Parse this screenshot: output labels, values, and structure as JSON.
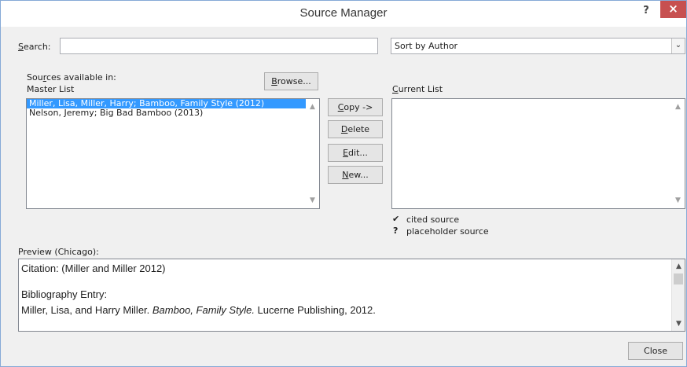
{
  "title": "Source Manager",
  "title_buttons": {
    "help": "?",
    "close": "×"
  },
  "search": {
    "label_key": "S",
    "label_rest": "earch:",
    "value": ""
  },
  "sort": {
    "selected": "Sort by Author",
    "arrow": "⌄"
  },
  "sources_available": {
    "prefix": "Sou",
    "key": "r",
    "suffix": "ces available in:",
    "list_name": "Master List"
  },
  "browse": {
    "key": "B",
    "rest": "rowse..."
  },
  "master_list": {
    "items": [
      "Miller, Lisa, Miller, Harry; Bamboo, Family Style (2012)",
      "Nelson, Jeremy; Big Bad Bamboo (2013)"
    ],
    "selected_index": 0
  },
  "actions": {
    "copy": {
      "key": "C",
      "rest": "opy ->"
    },
    "delete": {
      "key": "D",
      "rest": "elete"
    },
    "edit": {
      "key": "E",
      "rest": "dit..."
    },
    "new": {
      "key": "N",
      "rest": "ew..."
    }
  },
  "current_list": {
    "key": "C",
    "rest": "urrent List",
    "items": []
  },
  "legend": [
    {
      "symbol": "✔",
      "text": "cited source"
    },
    {
      "symbol": "?",
      "text": "placeholder source"
    }
  ],
  "preview": {
    "label": "Preview (Chicago):",
    "citation": "Citation:  (Miller and Miller 2012)",
    "bibliography_heading": "Bibliography Entry:",
    "bib_before": "Miller, Lisa, and Harry Miller. ",
    "bib_title": "Bamboo, Family Style.",
    "bib_after": " Lucerne Publishing, 2012."
  },
  "close_button": "Close",
  "scroll_arrows": {
    "up": "▲",
    "down": "▼"
  }
}
